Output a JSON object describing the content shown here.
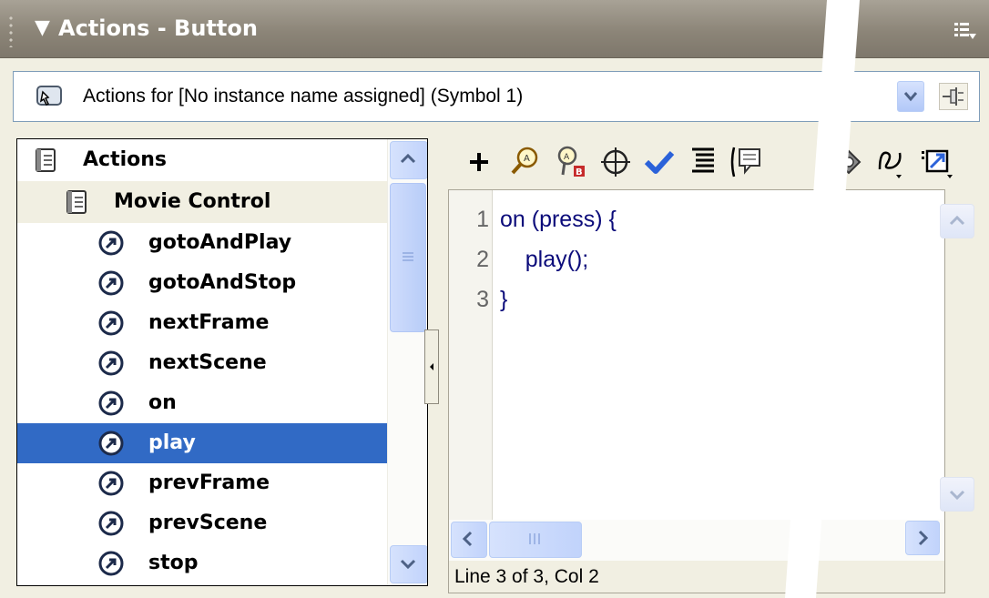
{
  "window": {
    "title": "Actions - Button"
  },
  "target": {
    "label": "Actions for [No instance name assigned]  (Symbol 1)"
  },
  "tree": {
    "root": "Actions",
    "category": "Movie Control",
    "items": [
      "gotoAndPlay",
      "gotoAndStop",
      "nextFrame",
      "nextScene",
      "on",
      "play",
      "prevFrame",
      "prevScene",
      "stop"
    ],
    "selected": "play"
  },
  "toolbar": {
    "icons": [
      "add-statement-icon",
      "find-icon",
      "replace-icon",
      "insert-target-path-icon",
      "check-syntax-icon",
      "auto-format-icon",
      "show-code-hint-icon",
      "reference-icon",
      "debug-options-icon",
      "view-options-icon"
    ]
  },
  "editor": {
    "line_numbers": [
      "1",
      "2",
      "3"
    ],
    "lines": [
      "on (press) {",
      "    play();",
      "}"
    ]
  },
  "status": {
    "text": "Line 3 of 3, Col 2"
  },
  "colors": {
    "selection": "#316ac5",
    "titlebar": "#8c8578",
    "code_text": "#0b0b7a",
    "panel": "#f1efe2"
  }
}
